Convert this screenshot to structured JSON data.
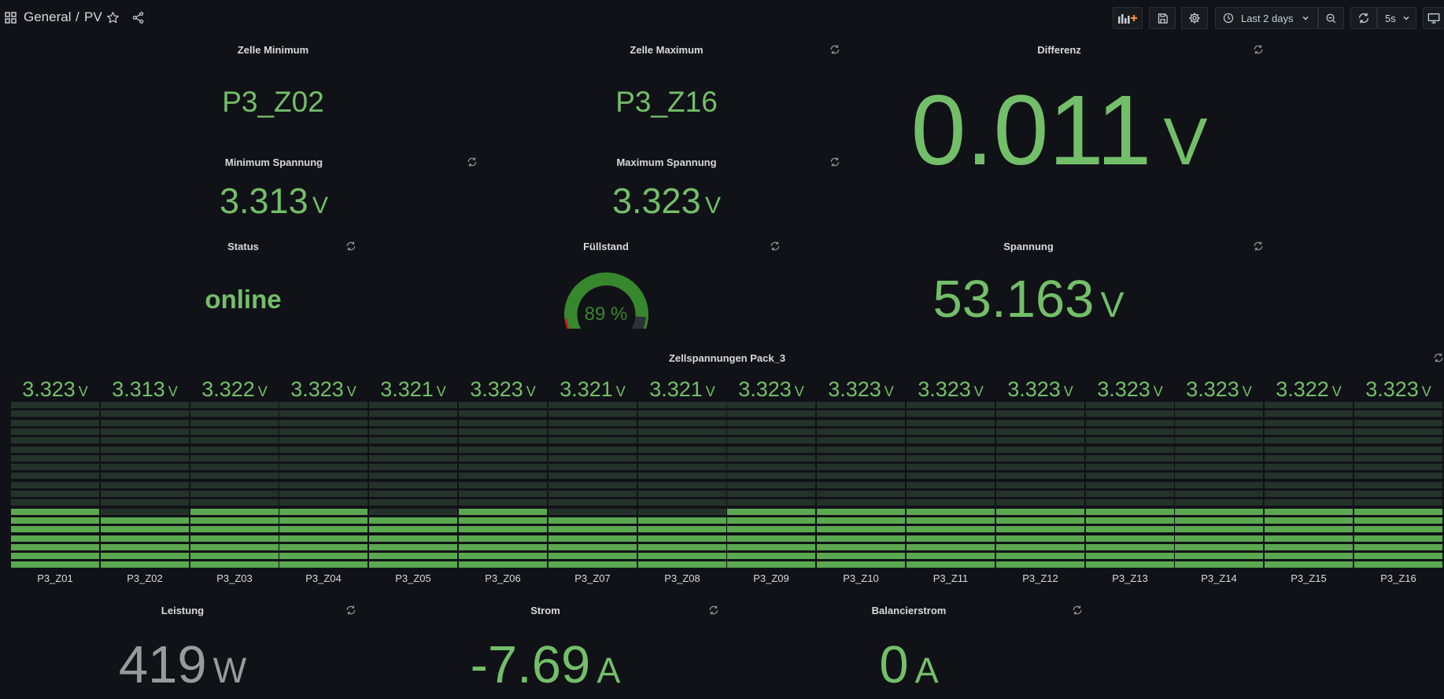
{
  "header": {
    "folder": "General",
    "separator": "/",
    "dashboard": "PV",
    "time_range": "Last 2 days",
    "refresh_interval": "5s"
  },
  "panels": {
    "zelle_min": {
      "title": "Zelle Minimum",
      "value": "P3_Z02"
    },
    "zelle_max": {
      "title": "Zelle Maximum",
      "value": "P3_Z16"
    },
    "differenz": {
      "title": "Differenz",
      "value": "0.011",
      "unit": "V"
    },
    "min_spannung": {
      "title": "Minimum Spannung",
      "value": "3.313",
      "unit": "V"
    },
    "max_spannung": {
      "title": "Maximum Spannung",
      "value": "3.323",
      "unit": "V"
    },
    "status": {
      "title": "Status",
      "value": "online"
    },
    "fuellstand": {
      "title": "Füllstand",
      "value": "89 %",
      "percent": 89
    },
    "spannung": {
      "title": "Spannung",
      "value": "53.163",
      "unit": "V"
    },
    "leistung": {
      "title": "Leistung",
      "value": "419",
      "unit": "W"
    },
    "strom": {
      "title": "Strom",
      "value": "-7.69",
      "unit": "A"
    },
    "balancierstrom": {
      "title": "Balancierstrom",
      "value": "0",
      "unit": "A"
    }
  },
  "zellspannungen": {
    "title": "Zellspannungen Pack_3",
    "unit": "V",
    "cells": [
      {
        "name": "P3_Z01",
        "value": "3.323",
        "level": 7
      },
      {
        "name": "P3_Z02",
        "value": "3.313",
        "level": 6
      },
      {
        "name": "P3_Z03",
        "value": "3.322",
        "level": 7
      },
      {
        "name": "P3_Z04",
        "value": "3.323",
        "level": 7
      },
      {
        "name": "P3_Z05",
        "value": "3.321",
        "level": 6
      },
      {
        "name": "P3_Z06",
        "value": "3.323",
        "level": 7
      },
      {
        "name": "P3_Z07",
        "value": "3.321",
        "level": 6
      },
      {
        "name": "P3_Z08",
        "value": "3.321",
        "level": 6
      },
      {
        "name": "P3_Z09",
        "value": "3.323",
        "level": 7
      },
      {
        "name": "P3_Z10",
        "value": "3.323",
        "level": 7
      },
      {
        "name": "P3_Z11",
        "value": "3.323",
        "level": 7
      },
      {
        "name": "P3_Z12",
        "value": "3.323",
        "level": 7
      },
      {
        "name": "P3_Z13",
        "value": "3.323",
        "level": 7
      },
      {
        "name": "P3_Z14",
        "value": "3.323",
        "level": 7
      },
      {
        "name": "P3_Z15",
        "value": "3.322",
        "level": 7
      },
      {
        "name": "P3_Z16",
        "value": "3.323",
        "level": 7
      }
    ],
    "segments_total": 19
  },
  "colors": {
    "value_green": "#73bf69",
    "gauge_green": "#37872d",
    "gauge_track": "#2c3235",
    "gauge_red": "#c4162a",
    "power_gray": "#9a9a9a",
    "segment_dark": "#24332a",
    "segment_lit": "#5aa84f"
  }
}
